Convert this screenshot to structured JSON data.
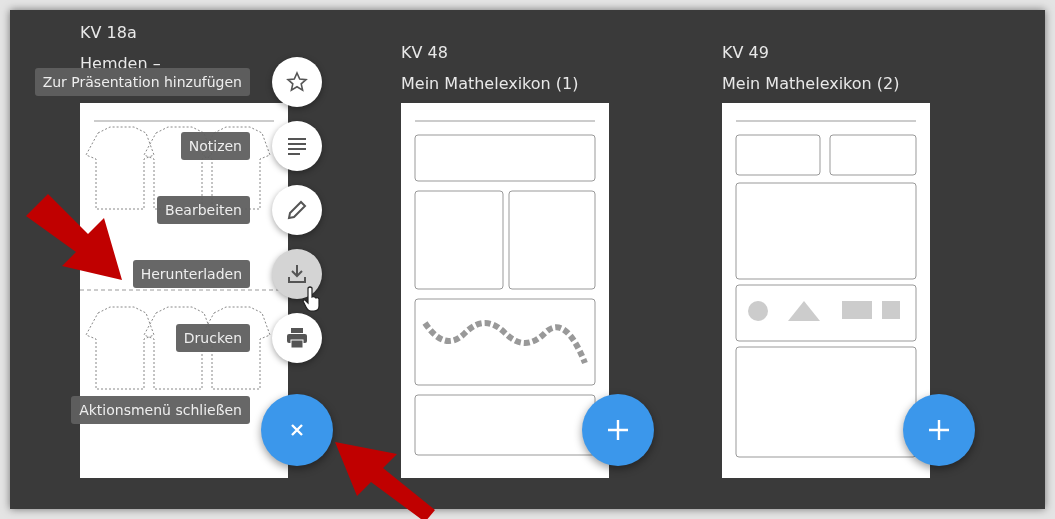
{
  "cards": [
    {
      "code": "KV 18a",
      "title": "Hemden –",
      "kind": "shirts",
      "menu_open": true
    },
    {
      "code": "KV 48",
      "title": "Mein Mathelexikon (1)",
      "kind": "lexicon",
      "menu_open": false
    },
    {
      "code": "KV 49",
      "title": "Mein Mathelexikon (2)",
      "kind": "shapes",
      "menu_open": false
    }
  ],
  "action_menu": {
    "items": [
      {
        "kind": "star",
        "label": "Zur Präsentation hinzufügen",
        "hovered": false
      },
      {
        "kind": "notes",
        "label": "Notizen",
        "hovered": false
      },
      {
        "kind": "pencil",
        "label": "Bearbeiten",
        "hovered": false
      },
      {
        "kind": "download",
        "label": "Herunterladen",
        "hovered": true
      },
      {
        "kind": "print",
        "label": "Drucken",
        "hovered": false
      }
    ],
    "close_label": "Aktionsmenü schließen"
  }
}
